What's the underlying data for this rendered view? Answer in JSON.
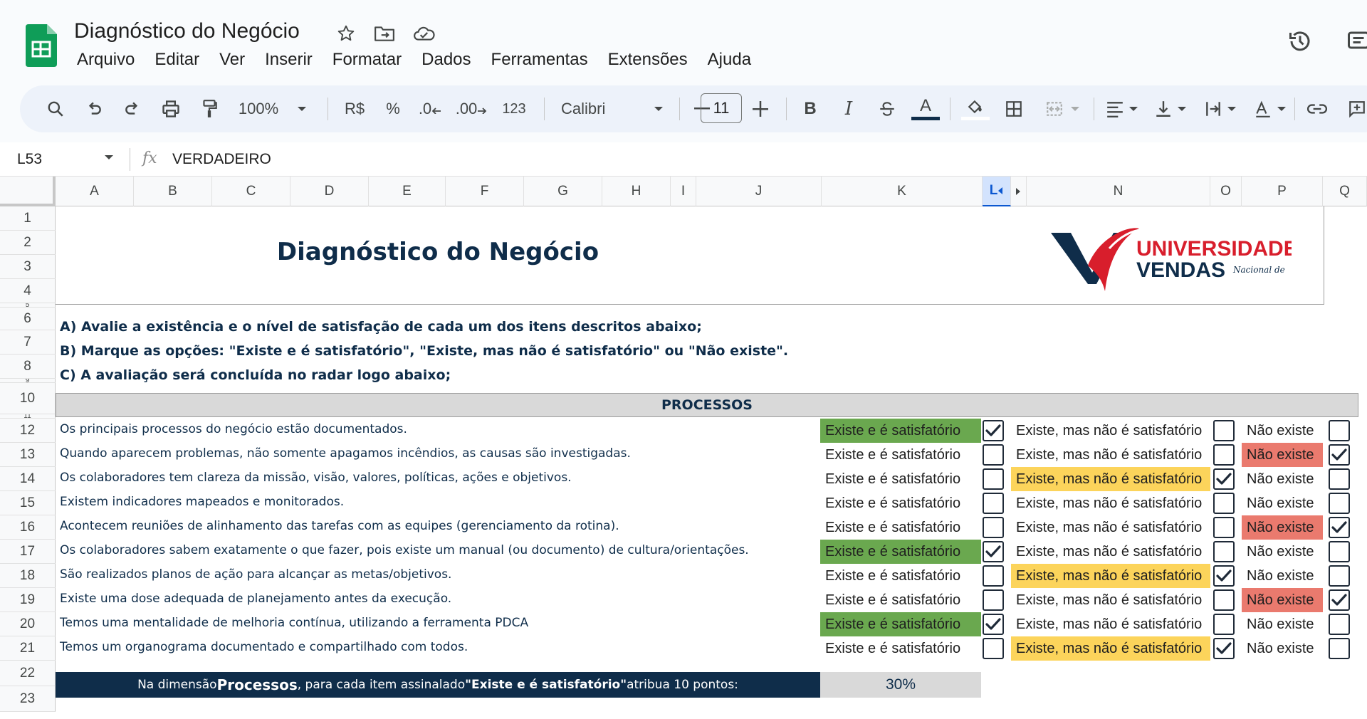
{
  "app": {
    "doc_title": "Diagnóstico do Negócio",
    "menu": [
      "Arquivo",
      "Editar",
      "Ver",
      "Inserir",
      "Formatar",
      "Dados",
      "Ferramentas",
      "Extensões",
      "Ajuda"
    ]
  },
  "toolbar": {
    "zoom": "100%",
    "currency": "R$",
    "percent": "%",
    "decrease_decimals": ".0",
    "increase_decimals": ".00",
    "number_format": "123",
    "font": "Calibri",
    "font_size": "11",
    "bold": "B",
    "italic": "I",
    "text_color_letter": "A"
  },
  "formula_bar": {
    "cell_ref": "L53",
    "fx": "fx",
    "value": "VERDADEIRO"
  },
  "grid": {
    "columns": [
      "A",
      "B",
      "C",
      "D",
      "E",
      "F",
      "G",
      "H",
      "I",
      "J",
      "K",
      "L",
      "N",
      "O",
      "P",
      "Q"
    ],
    "selected_column": "L",
    "rows": [
      "1",
      "2",
      "3",
      "4",
      "5",
      "6",
      "7",
      "8",
      "9",
      "10",
      "11",
      "12",
      "13",
      "14",
      "15",
      "16",
      "17",
      "18",
      "19",
      "20",
      "21",
      "22",
      "23"
    ]
  },
  "sheet": {
    "title": "Diagnóstico do Negócio",
    "brand": {
      "line1": "UNIVERSIDADE",
      "line2": "VENDAS",
      "script": "Nacional de"
    },
    "instructions": [
      "A) Avalie a existência e o nível de satisfação de cada um dos itens descritos abaixo;",
      "B) Marque as opções: \"Existe e é satisfatório\", \"Existe, mas não é satisfatório\" ou \"Não existe\".",
      "C) A avaliação será concluída no radar logo abaixo;"
    ],
    "section": "PROCESSOS",
    "options": {
      "sat": "Existe e é satisfatório",
      "mid": "Existe, mas não é satisfatório",
      "none": "Não existe"
    },
    "colors": {
      "sat": "#6aa84f",
      "mid": "#fcd45b",
      "none": "#ea7a6e",
      "navy": "#0f2d4a"
    },
    "items": [
      {
        "text": "Os principais processos do negócio estão documentados.",
        "choice": "sat"
      },
      {
        "text": "Quando aparecem problemas, não somente apagamos incêndios, as causas são investigadas.",
        "choice": "none"
      },
      {
        "text": "Os colaboradores tem clareza da missão, visão, valores, políticas, ações e objetivos.",
        "choice": "mid"
      },
      {
        "text": "Existem indicadores mapeados e monitorados.",
        "choice": ""
      },
      {
        "text": "Acontecem reuniões de alinhamento das tarefas com as equipes (gerenciamento da rotina).",
        "choice": "none"
      },
      {
        "text": "Os colaboradores sabem exatamente o que fazer, pois existe um manual (ou documento) de cultura/orientações.",
        "choice": "sat"
      },
      {
        "text": "São realizados planos de ação para alcançar as metas/objetivos.",
        "choice": "mid"
      },
      {
        "text": "Existe uma dose adequada de planejamento antes da execução.",
        "choice": "none"
      },
      {
        "text": "Temos uma mentalidade de melhoria contínua, utilizando a ferramenta PDCA",
        "choice": "sat"
      },
      {
        "text": "Temos um organograma documentado e compartilhado com todos.",
        "choice": "mid"
      }
    ],
    "score": {
      "prefix": "Na dimensão ",
      "dimension": "Processos",
      "middle": ", para cada item assinalado ",
      "quoted": "\"Existe e é satisfatório\"",
      "suffix": " atribua 10 pontos:",
      "value": "30%"
    }
  }
}
